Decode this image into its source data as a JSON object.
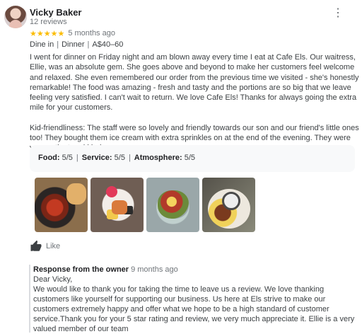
{
  "review": {
    "author": "Vicky Baker",
    "review_count": "12 reviews",
    "stars": "★★★★★",
    "date": "5 months ago",
    "meta": [
      "Dine in",
      "Dinner",
      "A$40–60"
    ],
    "paragraphs": [
      "I went for dinner on Friday night and am blown away every time I eat at Cafe Els. Our waitress, Ellie, was an absolute gem. She goes above and beyond to make her customers feel welcome and relaxed. She even remembered our order from the previous time we visited - she's honestly remarkable! The food was amazing - fresh and tasty and the portions are so big that we leave feeling very satisfied. I can't wait to return. We love Cafe Els! Thanks for always going the extra mile for your customers.",
      "Kid-friendliness: The staff were so lovely and friendly towards our son and our friend's little ones too! They bought them ice cream with extra sprinkles on at the end of the evening. They were very patient and kind."
    ],
    "attributes": [
      {
        "label": "Food:",
        "value": "5/5"
      },
      {
        "label": "Service:",
        "value": "5/5"
      },
      {
        "label": "Atmosphere:",
        "value": "5/5"
      }
    ],
    "like_label": "Like",
    "more_icon": "more-vert-icon",
    "star_color": "#fbbc04"
  },
  "owner_response": {
    "title": "Response from the owner",
    "date": "9 months ago",
    "greeting": "Dear Vicky,",
    "text": "We would like to thank you for taking the time to leave us a review. We love thanking customers like yourself for supporting our business. Us here at Els strive to make our customers extremely happy and offer what we hope to be a high standard of customer service.Thank you for your 5 star rating and review, we very much appreciate it. Ellie is a very valued member of our team"
  }
}
